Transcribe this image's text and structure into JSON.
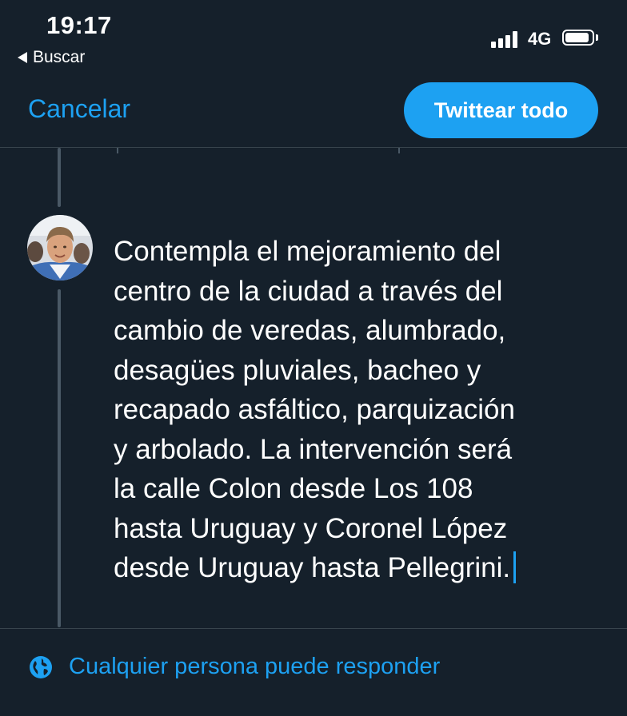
{
  "status_bar": {
    "time": "19:17",
    "back_app": "Buscar",
    "network": "4G",
    "battery_level": 0.9,
    "signal_bars": 4
  },
  "nav": {
    "cancel_label": "Cancelar",
    "tweet_all_label": "Twittear todo"
  },
  "composer": {
    "text": "Contempla el mejoramiento del\ncentro de la ciudad a través del\ncambio de veredas, alumbrado,\ndesagües pluviales, bacheo y\nrecapado asfáltico, parquización\ny arbolado. La intervención será\nla calle Colon desde Los 108\nhasta Uruguay y Coronel López\ndesde Uruguay hasta Pellegrini."
  },
  "footer": {
    "reply_setting_label": "Cualquier persona puede responder"
  },
  "colors": {
    "background": "#15202b",
    "accent": "#1da1f2",
    "divider": "#38444d",
    "thread_line": "#4a5966"
  }
}
